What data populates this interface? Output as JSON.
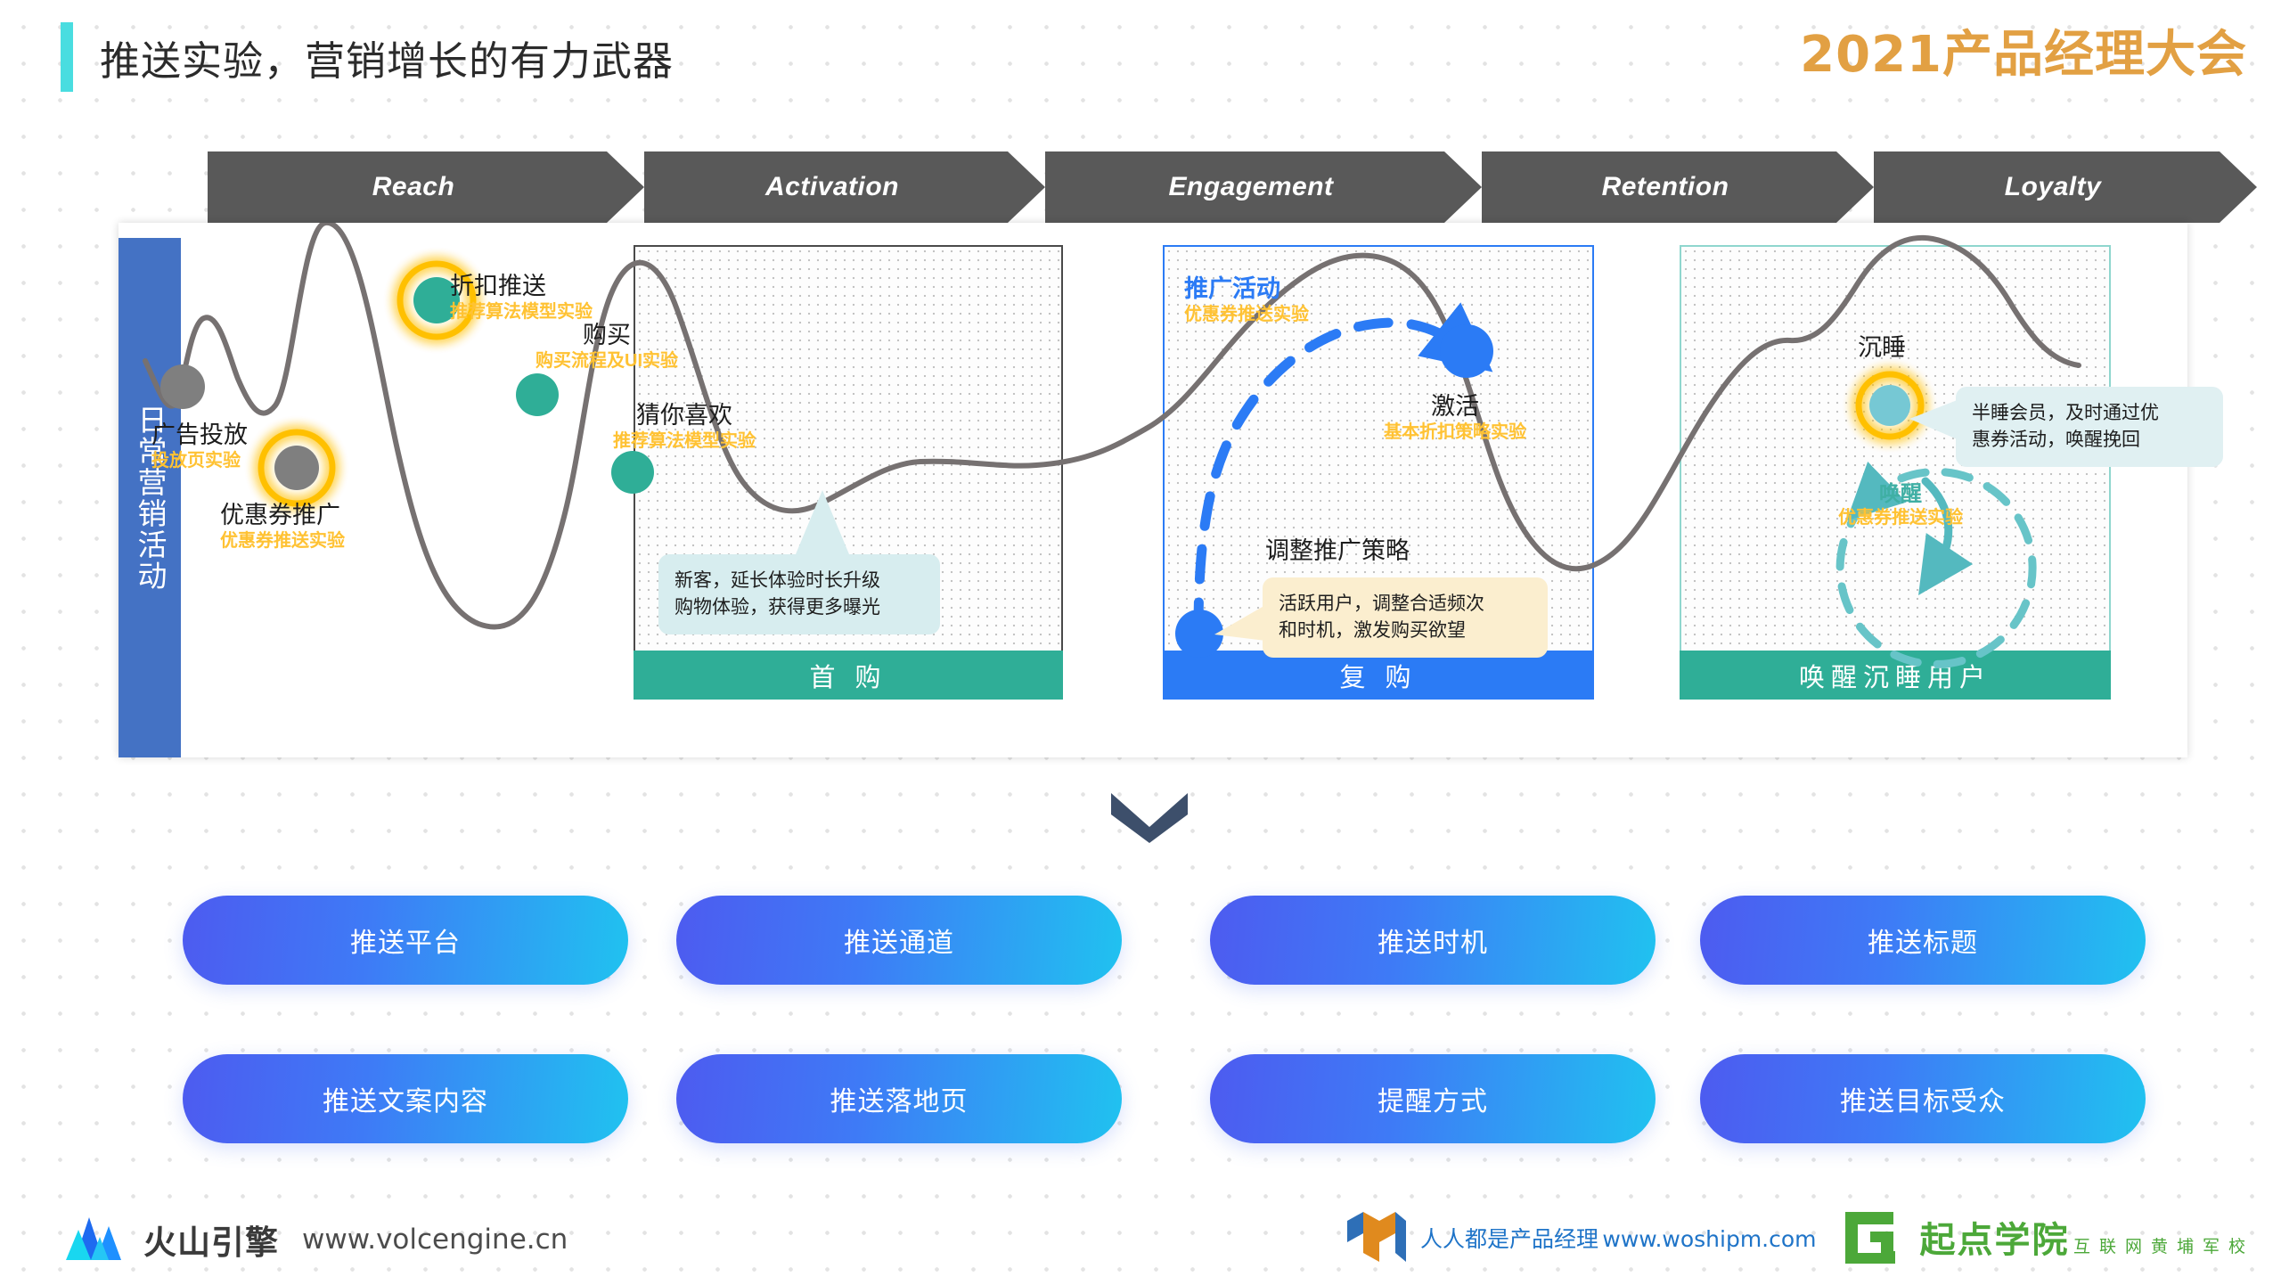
{
  "header": {
    "title": "推送实验，营销增长的有力武器",
    "accent_color": "#49DDE0",
    "conference_logo": "2021产品经理大会",
    "conference_logo_color": "#E2A043"
  },
  "funnel_stages": [
    {
      "label": "Reach"
    },
    {
      "label": "Activation"
    },
    {
      "label": "Engagement"
    },
    {
      "label": "Retention"
    },
    {
      "label": "Loyalty"
    }
  ],
  "diagram": {
    "sidebar_label": "日常营销活动",
    "sidebar_color": "#4472C4",
    "sections": [
      {
        "id": "first-purchase",
        "caption": "首 购",
        "accent": "#2FAE97",
        "border": "#4a4a4a"
      },
      {
        "id": "repurchase",
        "caption": "复 购",
        "accent": "#2B7BF5",
        "border": "#2B7BF5"
      },
      {
        "id": "reactivation",
        "caption": "唤醒沉睡用户",
        "accent": "#2FAE97",
        "border": "#8FD6CE"
      }
    ],
    "nodes": [
      {
        "id": "ad-delivery",
        "title": "广告投放",
        "experiment": "投放页实验",
        "dot_color": "#7F7F7F",
        "highlighted": false
      },
      {
        "id": "coupon-promo",
        "title": "优惠券推广",
        "experiment": "优惠券推送实验",
        "dot_color": "#7F7F7F",
        "highlighted": true
      },
      {
        "id": "discount-push",
        "title": "折扣推送",
        "experiment": "推荐算法模型实验",
        "dot_color": "#2FAE97",
        "highlighted": true
      },
      {
        "id": "purchase",
        "title": "购买",
        "experiment": "购买流程及UI实验",
        "dot_color": "#2FAE97",
        "highlighted": false
      },
      {
        "id": "guess-you-like",
        "title": "猜你喜欢",
        "experiment": "推荐算法模型实验",
        "dot_color": "#2FAE97",
        "highlighted": false
      },
      {
        "id": "promo-campaign",
        "title": "推广活动",
        "experiment": "优惠券推送实验",
        "dot_color": "#2B7BF5",
        "highlighted": false
      },
      {
        "id": "activate",
        "title": "激活",
        "experiment": "基本折扣策略实验",
        "dot_color": "#2B7BF5",
        "highlighted": false
      },
      {
        "id": "dormant",
        "title": "沉睡",
        "experiment": "",
        "dot_color": "#76C8D4",
        "highlighted": true
      },
      {
        "id": "awaken",
        "title": "唤醒",
        "experiment": "优惠券推送实验",
        "dot_color": "#3FAFA4",
        "highlighted": false
      }
    ],
    "plain_labels": [
      {
        "id": "adjust-promo-strategy",
        "text": "调整推广策略"
      }
    ],
    "callouts": [
      {
        "id": "new-customer-note",
        "text": "新客，延长体验时长升级\n购物体验，获得更多曝光",
        "style": "cyan"
      },
      {
        "id": "active-user-note",
        "text": "活跃用户，调整合适频次\n和时机，激发购买欲望",
        "style": "cream"
      },
      {
        "id": "half-asleep-note",
        "text": "半睡会员，及时通过优\n惠券活动，唤醒挽回",
        "style": "pale"
      }
    ],
    "curve_color": "#767171",
    "highlight_ring_color": "#FFC000",
    "experiment_text_color": "#FFC233"
  },
  "arrow_down": {
    "name": "chevron-down-icon",
    "color": "#3D4F6B"
  },
  "pills": [
    {
      "label": "推送平台"
    },
    {
      "label": "推送通道"
    },
    {
      "label": "推送时机"
    },
    {
      "label": "推送标题"
    },
    {
      "label": "推送文案内容"
    },
    {
      "label": "推送落地页"
    },
    {
      "label": "提醒方式"
    },
    {
      "label": "推送目标受众"
    }
  ],
  "pill_gradient": {
    "from": "#4D5BF0",
    "to": "#20C2F0"
  },
  "footer": {
    "volcengine_name": "火山引擎",
    "volcengine_url": "www.volcengine.cn",
    "woshipm_name": "人人都是产品经理",
    "woshipm_url": "www.woshipm.com",
    "qidian_name": "起点学院",
    "qidian_tagline": "互联网黄埔军校"
  }
}
